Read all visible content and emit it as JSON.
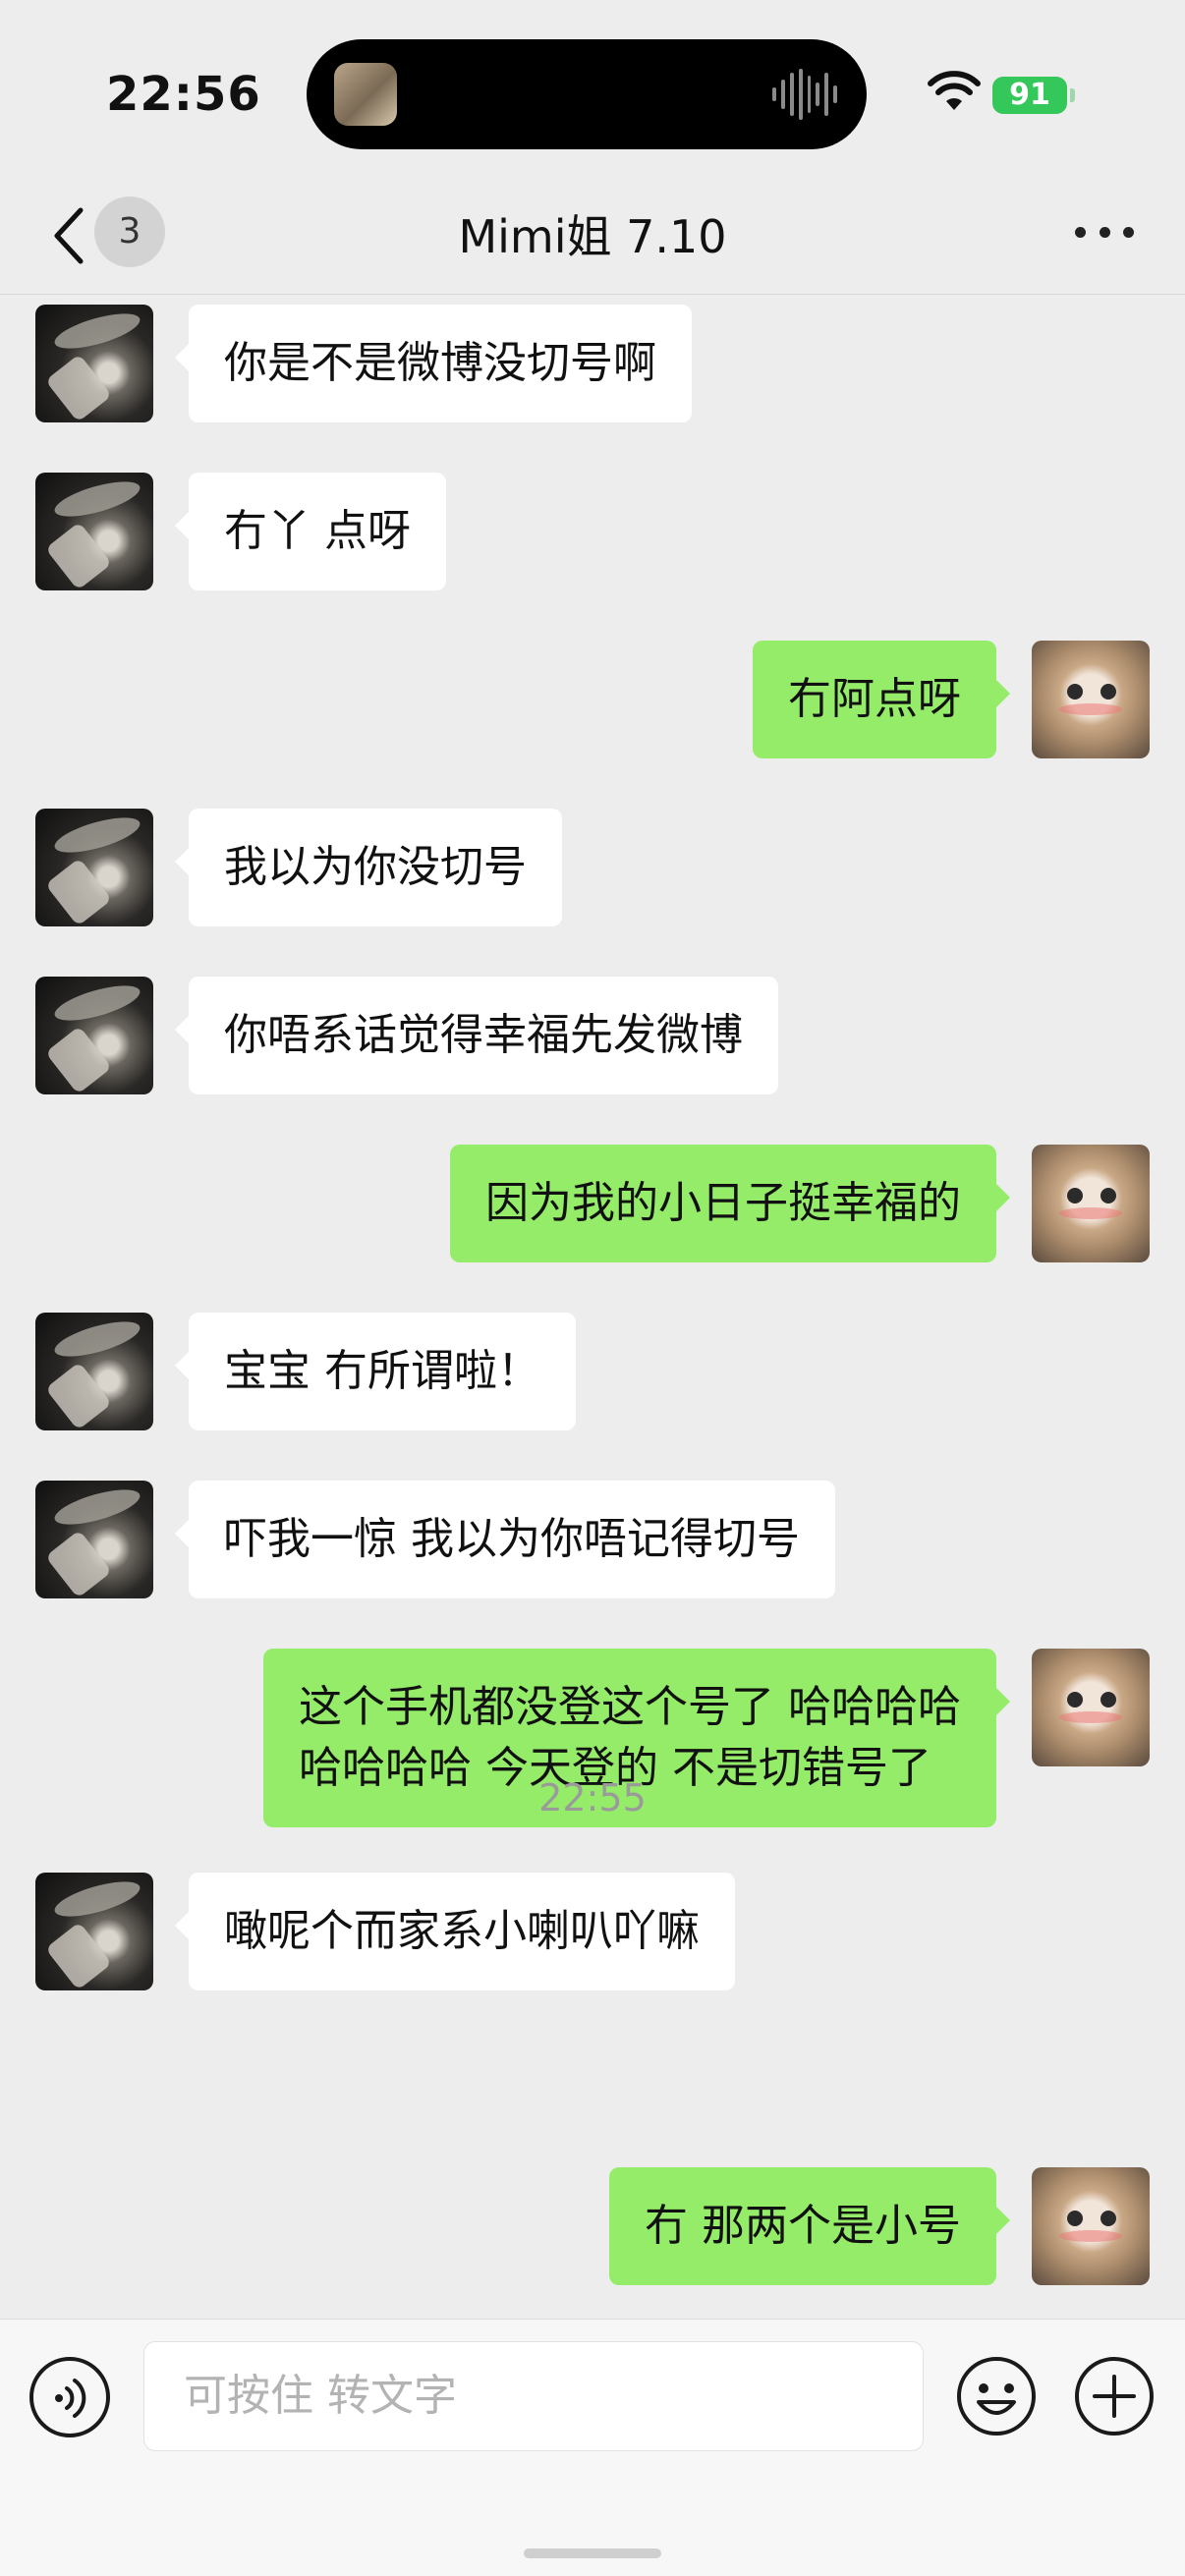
{
  "status": {
    "time": "22:56",
    "battery": "91"
  },
  "nav": {
    "unread_count": "3",
    "title": "Mimi姐 7.10"
  },
  "messages": [
    {
      "side": "left",
      "text": "你是不是微博没切号啊"
    },
    {
      "side": "left",
      "text": "冇丫 点呀"
    },
    {
      "side": "right",
      "text": "冇阿点呀"
    },
    {
      "side": "left",
      "text": "我以为你没切号"
    },
    {
      "side": "left",
      "text": "你唔系话觉得幸福先发微博"
    },
    {
      "side": "right",
      "text": "因为我的小日子挺幸福的"
    },
    {
      "side": "left",
      "text": "宝宝 冇所谓啦！"
    },
    {
      "side": "left",
      "text": "吓我一惊 我以为你唔记得切号"
    },
    {
      "side": "right",
      "text": "这个手机都没登这个号了 哈哈哈哈\n哈哈哈哈 今天登的 不是切错号了"
    },
    {
      "side": "left",
      "text": "噉呢个而家系小喇叭吖嘛"
    },
    {
      "side": "right",
      "text": "冇 那两个是小号"
    }
  ],
  "timestamp": "22:55",
  "input": {
    "placeholder": "可按住 转文字"
  },
  "icons": {
    "back": "chevron-left-icon",
    "more": "ellipsis-icon",
    "voice": "voice-icon",
    "emoji": "emoji-icon",
    "plus": "plus-icon"
  },
  "colors": {
    "sent_bubble": "#95ec69",
    "received_bubble": "#ffffff",
    "background": "#ededed"
  }
}
